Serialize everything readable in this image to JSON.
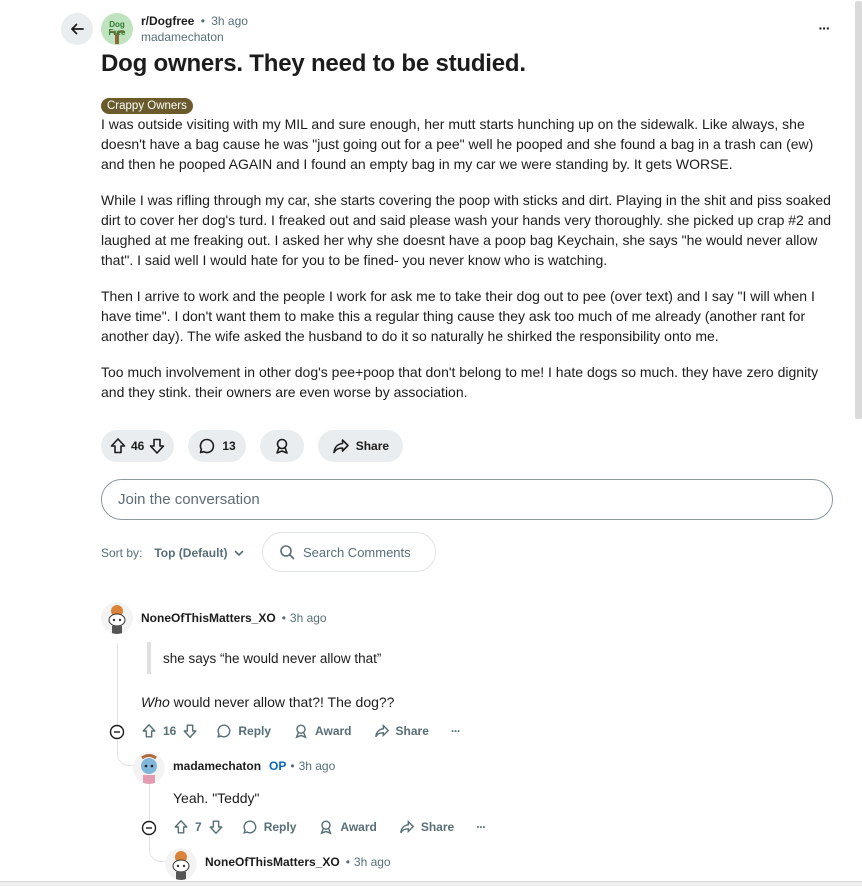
{
  "post": {
    "subreddit": "r/Dogfree",
    "subreddit_avatar_text": "Dog Free",
    "time": "3h ago",
    "author": "madamechaton",
    "title": "Dog owners. They need to be studied.",
    "flair": "Crappy Owners",
    "flair_color": "#6b5a2c",
    "paragraphs": [
      "I was outside visiting with my MIL and sure enough, her mutt starts hunching up on the sidewalk. Like always, she doesn't have a bag cause he was \"just going out for a pee\" well he pooped and she found a bag in a trash can (ew) and then he pooped AGAIN and I found an empty bag in my car we were standing by. It gets WORSE.",
      "While I was rifling through my car, she starts covering the poop with sticks and dirt. Playing in the shit and piss soaked dirt to cover her dog's turd. I freaked out and said please wash your hands very thoroughly. she picked up crap #2 and laughed at me freaking out. I asked her why she doesnt have a poop bag Keychain, she says \"he would never allow that\". I said well I would hate for you to be fined- you never know who is watching.",
      "Then I arrive to work and the people I work for ask me to take their dog out to pee (over text) and I say \"I will when I have time\". I don't want them to make this a regular thing cause they ask too much of me already (another rant for another day). The wife asked the husband to do it so naturally he shirked the responsibility onto me.",
      "Too much involvement in other dog's pee+poop that don't belong to me! I hate dogs so much. they have zero dignity and they stink. their owners are even worse by association."
    ],
    "votes": "46",
    "comments": "13",
    "share_label": "Share"
  },
  "composer": {
    "placeholder": "Join the conversation"
  },
  "sort": {
    "label": "Sort by:",
    "value": "Top (Default)"
  },
  "search": {
    "placeholder": "Search Comments"
  },
  "comments": [
    {
      "author": "NoneOfThisMatters_XO",
      "time": "3h ago",
      "quote": "she says “he would never allow that”",
      "text_italic": "Who",
      "text_rest": " would never allow that?! The dog??",
      "votes": "16",
      "reply_label": "Reply",
      "award_label": "Award",
      "share_label": "Share"
    },
    {
      "author": "madamechaton",
      "op_label": "OP",
      "time": "3h ago",
      "text": "Yeah. \"Teddy\"",
      "votes": "7",
      "reply_label": "Reply",
      "award_label": "Award",
      "share_label": "Share"
    },
    {
      "author": "NoneOfThisMatters_XO",
      "time": "3h ago"
    }
  ],
  "separator": "•",
  "more_glyph": "···"
}
